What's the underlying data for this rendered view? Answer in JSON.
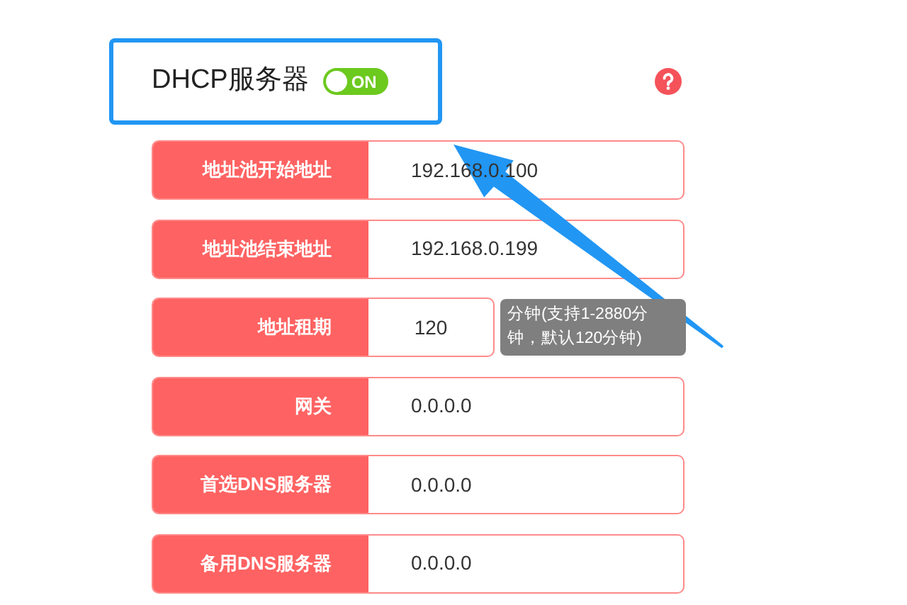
{
  "header": {
    "title": "DHCP服务器",
    "toggle": {
      "label": "ON",
      "on": true
    }
  },
  "fields": [
    {
      "kind": "field",
      "label": "地址池开始地址",
      "value": "192.168.0.100"
    },
    {
      "kind": "field",
      "label": "地址池结束地址",
      "value": "192.168.0.199"
    },
    {
      "kind": "short",
      "label": "地址租期",
      "value": "120",
      "hint": "分钟(支持1-2880分钟，默认120分钟)"
    },
    {
      "kind": "field",
      "label": "网关",
      "value": "0.0.0.0"
    },
    {
      "kind": "field",
      "label": "首选DNS服务器",
      "value": "0.0.0.0"
    },
    {
      "kind": "field",
      "label": "备用DNS服务器",
      "value": "0.0.0.0"
    }
  ]
}
